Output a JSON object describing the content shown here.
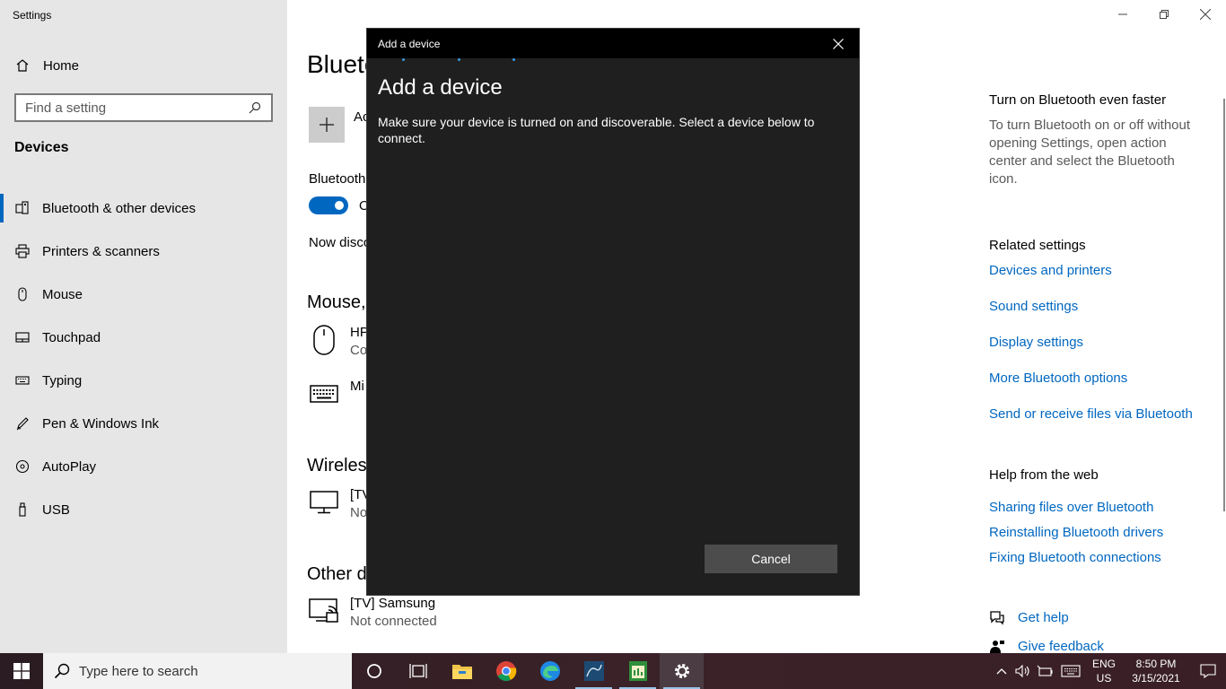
{
  "app": {
    "title": "Settings",
    "home_label": "Home",
    "search_placeholder": "Find a setting",
    "section_title": "Devices"
  },
  "nav": {
    "items": [
      {
        "label": "Bluetooth & other devices",
        "icon": "bluetooth-devices-icon",
        "active": true
      },
      {
        "label": "Printers & scanners",
        "icon": "printer-icon"
      },
      {
        "label": "Mouse",
        "icon": "mouse-icon"
      },
      {
        "label": "Touchpad",
        "icon": "touchpad-icon"
      },
      {
        "label": "Typing",
        "icon": "keyboard-icon"
      },
      {
        "label": "Pen & Windows Ink",
        "icon": "pen-icon"
      },
      {
        "label": "AutoPlay",
        "icon": "autoplay-icon"
      },
      {
        "label": "USB",
        "icon": "usb-icon"
      }
    ]
  },
  "main": {
    "page_title": "Blueto",
    "add_label": "Ac",
    "bluetooth_label": "Bluetooth",
    "toggle_label": "O",
    "discover_text": "Now disco",
    "mouse_group": "Mouse,",
    "device_hp_name": "HP",
    "device_hp_status": "Co",
    "device_mic_name": "Mi",
    "wireless_group": "Wireles",
    "device_tv1_name": "[TV",
    "device_tv1_status": "No",
    "other_group": "Other d",
    "device_tv2_name": "[TV] Samsung",
    "device_tv2_status": "Not connected"
  },
  "right": {
    "faster_heading": "Turn on Bluetooth even faster",
    "faster_text": "To turn Bluetooth on or off without opening Settings, open action center and select the Bluetooth icon.",
    "related_heading": "Related settings",
    "related_links": [
      "Devices and printers",
      "Sound settings",
      "Display settings",
      "More Bluetooth options",
      "Send or receive files via Bluetooth"
    ],
    "help_heading": "Help from the web",
    "help_links": [
      "Sharing files over Bluetooth",
      "Reinstalling Bluetooth drivers",
      "Fixing Bluetooth connections"
    ],
    "get_help": "Get help",
    "give_feedback": "Give feedback"
  },
  "dialog": {
    "window_title": "Add a device",
    "heading": "Add a device",
    "description": "Make sure your device is turned on and discoverable. Select a device below to connect.",
    "cancel_label": "Cancel"
  },
  "taskbar": {
    "search_text": "Type here to search",
    "lang_line1": "ENG",
    "lang_line2": "US",
    "time": "8:50 PM",
    "date": "3/15/2021"
  },
  "colors": {
    "accent": "#0067c0",
    "dialog_bg": "#1f1f1f",
    "sidebar_bg": "#e6e6e6"
  }
}
